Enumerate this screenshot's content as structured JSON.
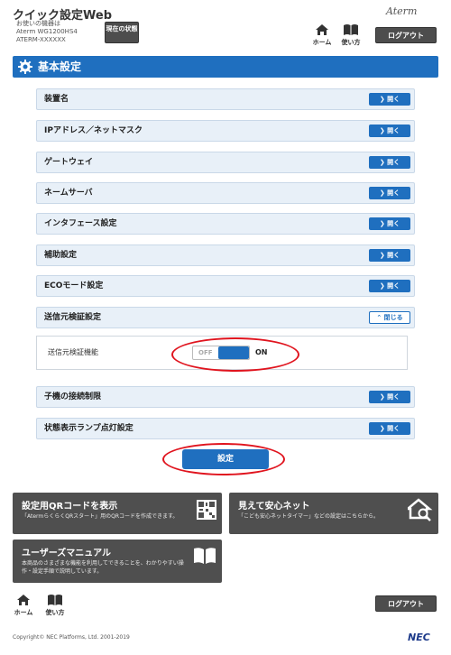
{
  "header": {
    "title": "クイック設定Web",
    "device_label": "お使いの機器は",
    "device_model": "Aterm WG1200HS4",
    "device_ssid": "ATERM-XXXXXX",
    "status_button": "現在の状態",
    "home_label": "ホーム",
    "manual_label": "使い方",
    "logo": "Aterm",
    "logout": "ログアウト"
  },
  "section": {
    "title": "基本設定"
  },
  "rows": [
    {
      "label": "装置名",
      "button": "開く"
    },
    {
      "label": "IPアドレス／ネットマスク",
      "button": "開く"
    },
    {
      "label": "ゲートウェイ",
      "button": "開く"
    },
    {
      "label": "ネームサーバ",
      "button": "開く"
    },
    {
      "label": "インタフェース設定",
      "button": "開く"
    },
    {
      "label": "補助設定",
      "button": "開く"
    },
    {
      "label": "ECOモード設定",
      "button": "開く"
    },
    {
      "label": "送信元検証設定",
      "button": "閉じる"
    },
    {
      "label": "子機の接続制限",
      "button": "開く"
    },
    {
      "label": "状態表示ランプ点灯設定",
      "button": "開く"
    }
  ],
  "subsetting": {
    "label": "送信元検証機能",
    "off_label": "OFF",
    "on_label": "ON",
    "state": "ON"
  },
  "submit_label": "設定",
  "cards": {
    "qr": {
      "title": "設定用QRコードを表示",
      "desc": "「AtermらくらくQRスタート」用のQRコードを作成できます。"
    },
    "safe": {
      "title": "見えて安心ネット",
      "desc": "「こども安心ネットタイマー」などの設定はこちらから。"
    },
    "manual": {
      "title": "ユーザーズマニュアル",
      "desc": "本商品のさまざまな機能を利用してできることを、わかりやすい操作・設定手順で説明しています。"
    }
  },
  "footer": {
    "home_label": "ホーム",
    "manual_label": "使い方",
    "logout": "ログアウト",
    "copyright": "Copyright© NEC Platforms, Ltd. 2001-2019",
    "brand": "NEC"
  },
  "colors": {
    "accent": "#1f6fbf",
    "highlight": "#e0141e",
    "card": "#4f4f4f"
  }
}
